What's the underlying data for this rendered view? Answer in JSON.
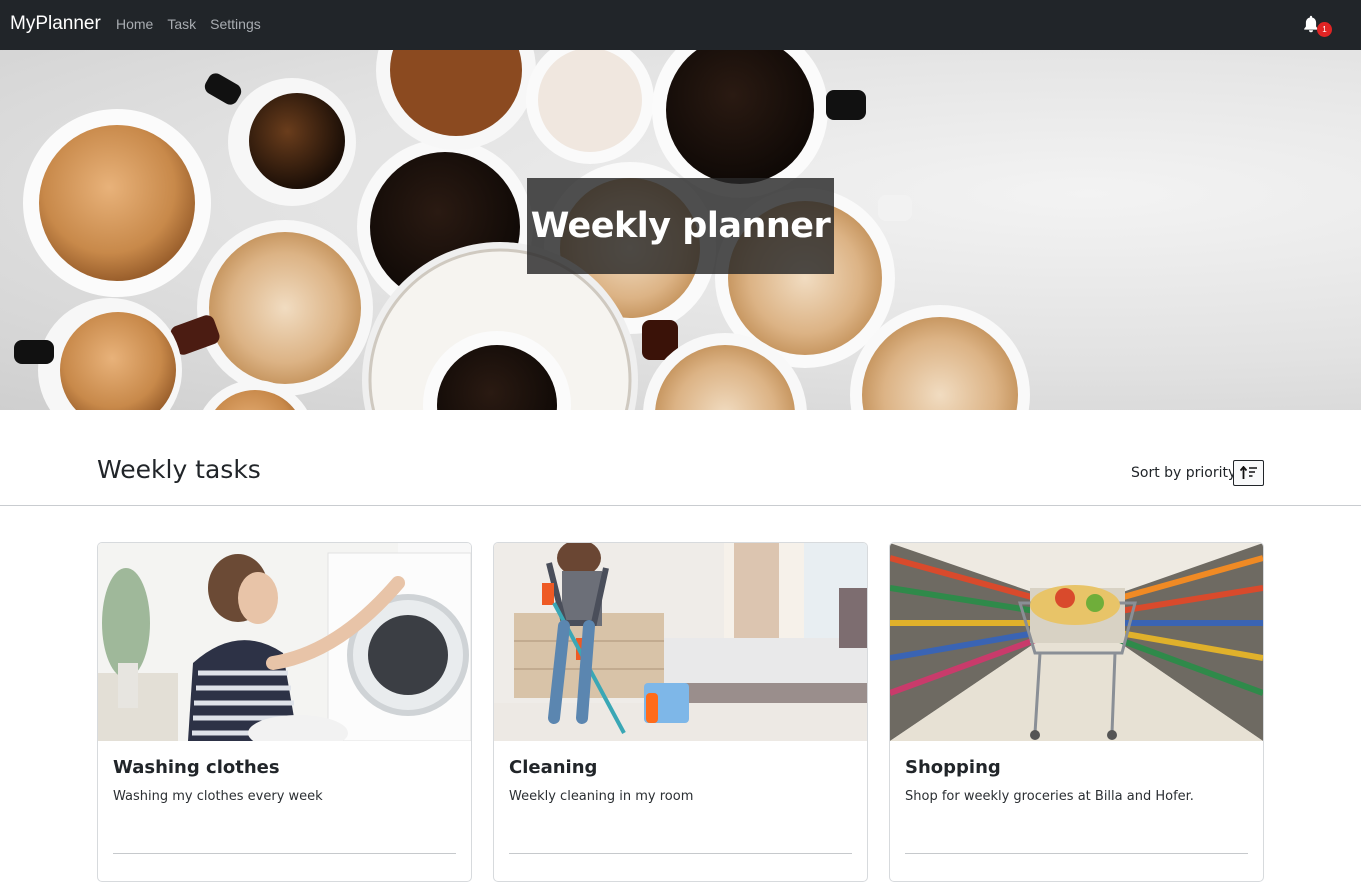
{
  "navbar": {
    "brand": "MyPlanner",
    "links": [
      "Home",
      "Task",
      "Settings"
    ],
    "notification_count": "1"
  },
  "hero": {
    "title": "Weekly planner"
  },
  "tasks_section": {
    "title": "Weekly tasks",
    "sort_label": "Sort by priority:",
    "sort_icon": "sort-ascending-icon"
  },
  "cards": [
    {
      "title": "Washing clothes",
      "text": "Washing my clothes every week"
    },
    {
      "title": "Cleaning",
      "text": "Weekly cleaning in my room"
    },
    {
      "title": "Shopping",
      "text": "Shop for weekly groceries at Billa and Hofer."
    }
  ],
  "colors": {
    "navbar_bg": "#212529",
    "badge": "#e02424",
    "hero_overlay": "#282828"
  }
}
